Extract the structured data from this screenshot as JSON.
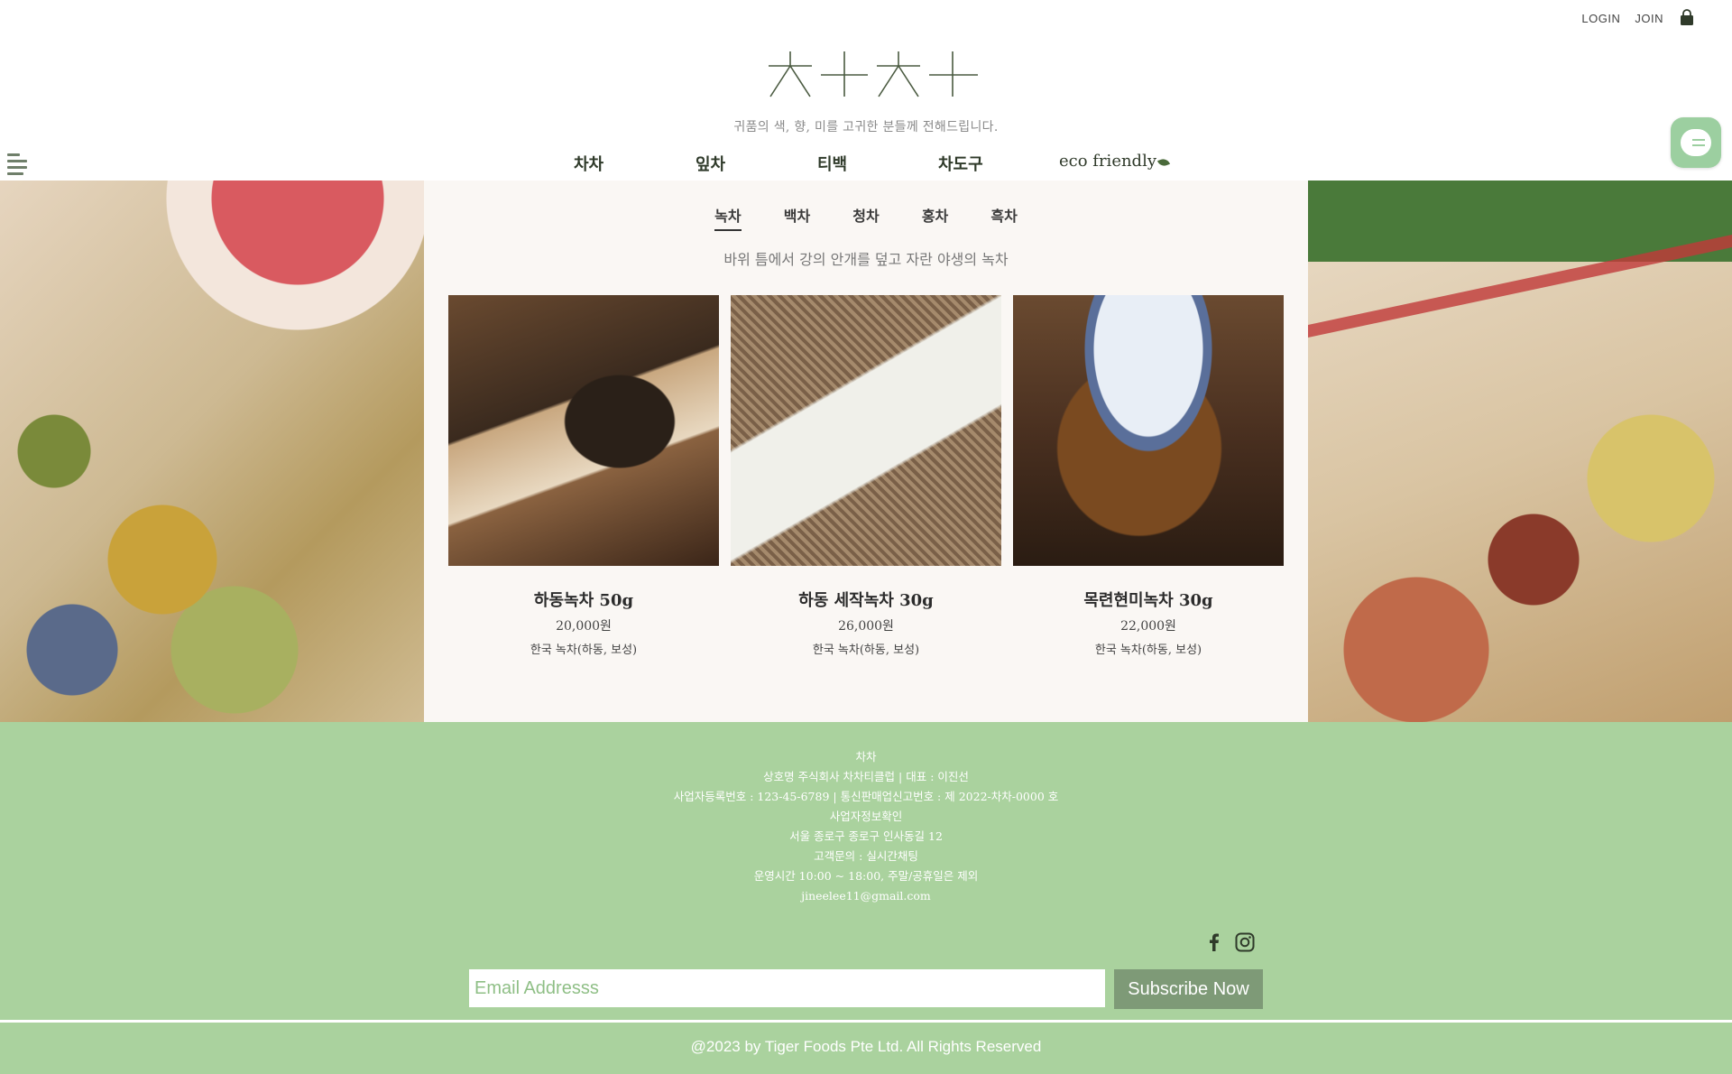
{
  "header": {
    "login_label": "LOGIN",
    "join_label": "JOIN",
    "cart_icon": "shopping-bag-icon",
    "logo_text": "차차",
    "tagline": "귀품의 색, 향, 미를 고귀한 분들께 전해드립니다."
  },
  "nav": {
    "items": [
      {
        "label": "차차"
      },
      {
        "label": "잎차"
      },
      {
        "label": "티백"
      },
      {
        "label": "차도구"
      },
      {
        "label": "eco friendly"
      }
    ]
  },
  "sub_nav": {
    "tabs": [
      {
        "label": "녹차",
        "active": true
      },
      {
        "label": "백차"
      },
      {
        "label": "청차"
      },
      {
        "label": "홍차"
      },
      {
        "label": "흑차"
      }
    ],
    "description": "바위 틈에서 강의 안개를 덮고 자란 야생의 녹차"
  },
  "products": [
    {
      "name": "하동녹차 50g",
      "price": "20,000원",
      "origin": "한국 녹차(하동, 보성)"
    },
    {
      "name": "하동 세작녹차 30g",
      "price": "26,000원",
      "origin": "한국 녹차(하동, 보성)"
    },
    {
      "name": "목련현미녹차 30g",
      "price": "22,000원",
      "origin": "한국 녹차(하동, 보성)"
    }
  ],
  "footer": {
    "lines": [
      "차차",
      "상호명 주식회사 차차티클럽 | 대표 : 이진선",
      "사업자등록번호 : 123-45-6789 | 통신판매업신고번호 : 제 2022-차차-0000 호",
      "사업자정보확인",
      "서울 종로구 종로구 인사동길 12",
      "고객문의 : 실시간채팅",
      "운영시간 10:00 ~ 18:00, 주말/공휴일은 제외",
      "jineelee11@gmail.com"
    ],
    "email_placeholder": "Email Addresss",
    "subscribe_label": "Subscribe Now",
    "copyright": "@2023 by Tiger Foods Pte Ltd. All Rights Reserved"
  },
  "colors": {
    "footer_bg": "#aad29e",
    "button_bg": "#7e9a77",
    "chat_bg": "#9ccfa0"
  }
}
